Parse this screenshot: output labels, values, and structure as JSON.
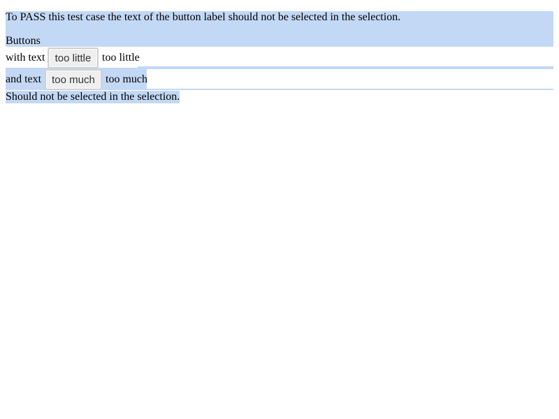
{
  "instruction": "To PASS this test case the text of the button label should not be selected in the selection.",
  "heading": "Buttons",
  "row1": {
    "prefix": "with text",
    "button_label": "too little",
    "suffix": "too little"
  },
  "row2": {
    "prefix": "and text",
    "button_label": "too much",
    "suffix": "too much"
  },
  "footer": "Should not be selected in the selection.",
  "colors": {
    "selection": "#c3d8f5",
    "button_background": "#efefef",
    "button_text": "#333333"
  }
}
